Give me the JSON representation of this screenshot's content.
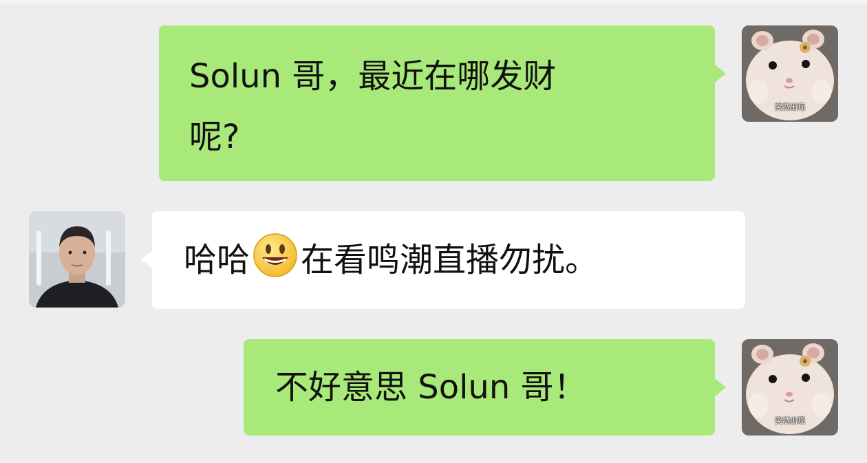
{
  "messages": [
    {
      "direction": "outgoing",
      "text_line1": "Solun 哥，最近在哪发财",
      "text_line2": "呢?",
      "avatar_caption": "突然出现"
    },
    {
      "direction": "incoming",
      "text_before_emoji": "哈哈",
      "emoji": "grinning-face-emoji",
      "text_after_emoji": "在看鸣潮直播勿扰。"
    },
    {
      "direction": "outgoing",
      "text": "不好意思 Solun 哥！",
      "avatar_caption": "突然出现"
    }
  ],
  "colors": {
    "background": "#ededed",
    "outgoing_bubble": "#a9e97a",
    "incoming_bubble": "#ffffff",
    "text": "#111111"
  }
}
